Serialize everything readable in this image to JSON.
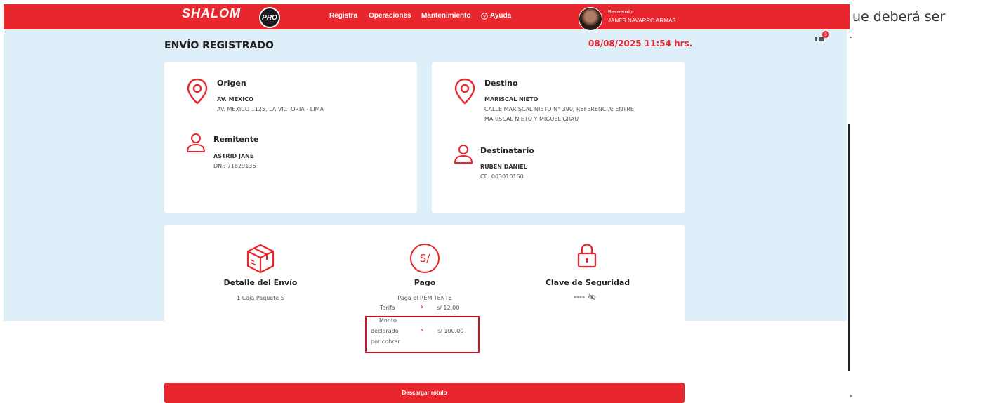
{
  "header": {
    "brand": "SHALOM",
    "brand_badge": "PRO",
    "nav": [
      "Registra",
      "Operaciones",
      "Mantenimiento",
      "Ayuda"
    ],
    "welcome": "Bienvenido",
    "username": "JANES NAVARRO ARMAS"
  },
  "side_text": "ue deberá ser",
  "page": {
    "title": "ENVÍO REGISTRADO",
    "date": "08/08/2025 11:54 hrs."
  },
  "origin": {
    "heading": "Origen",
    "name": "AV. MEXICO",
    "address": "AV. MEXICO 1125, LA VICTORIA - LIMA"
  },
  "sender": {
    "heading": "Remitente",
    "name": "ASTRID JANE",
    "doc": "DNI: 71829136"
  },
  "destination": {
    "heading": "Destino",
    "name": "MARISCAL NIETO",
    "address_line1": "CALLE MARISCAL NIETO N° 390, REFERENCIA: ENTRE",
    "address_line2": "MARISCAL NIETO Y MIGUEL GRAU"
  },
  "recipient": {
    "heading": "Destinatario",
    "name": "RUBEN DANIEL",
    "doc": "CE: 003010160"
  },
  "shipment": {
    "heading": "Detalle del Envío",
    "detail": "1 Caja Paquete S"
  },
  "payment": {
    "icon_text": "S/",
    "heading": "Pago",
    "payer": "Paga el REMITENTE",
    "tariff_label": "Tarifa",
    "tariff_value": "s/ 12.00",
    "declared_label_1": "Monto",
    "declared_label_2": "declarado",
    "declared_label_3": "por cobrar",
    "declared_value": "s/ 100.00"
  },
  "security": {
    "heading": "Clave de Seguridad",
    "masked": "****"
  },
  "download_label": "Descargar rótulo",
  "colors": {
    "brand_red": "#e8262e",
    "light_bg": "#dfeff9"
  }
}
